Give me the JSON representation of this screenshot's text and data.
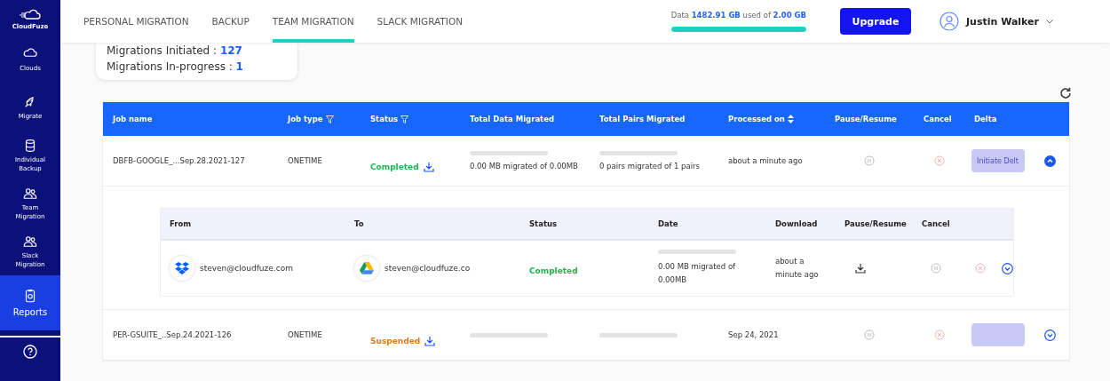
{
  "sidebar": {
    "brand": "CloudFuze",
    "items": [
      {
        "label": "Clouds",
        "selected": false
      },
      {
        "label": "Migrate",
        "selected": false
      },
      {
        "label": "Individual Backup",
        "selected": false
      },
      {
        "label": "Team Migration",
        "selected": false
      },
      {
        "label": "Slack Migration",
        "selected": false
      },
      {
        "label": "Reports",
        "selected": true
      }
    ]
  },
  "tabs": [
    {
      "label": "PERSONAL MIGRATION",
      "selected": false
    },
    {
      "label": "BACKUP",
      "selected": false
    },
    {
      "label": "TEAM MIGRATION",
      "selected": true
    },
    {
      "label": "SLACK MIGRATION",
      "selected": false
    }
  ],
  "storage": {
    "text": "Data **1482.91 GB** used of **2.00 GB**",
    "level": 1
  },
  "upgrade_button": "Upgrade",
  "user": {
    "name": "Justin Walker"
  },
  "stats": [
    {
      "label": "Migrations Initiated :",
      "value": "127"
    },
    {
      "label": "Migrations In-progress :",
      "value": "1"
    }
  ],
  "table": {
    "columns": [
      "Job name",
      "Job type",
      "Status",
      "Total Data Migrated",
      "Total Pairs Migrated",
      "Processed on",
      "Pause/Resume",
      "Cancel",
      "Delta"
    ],
    "rows": [
      {
        "job_name": "DBFB-GOOGLE_...Sep.28.2021-127",
        "job_type": "ONETIME",
        "status": {
          "text": "Completed",
          "kind": "completed"
        },
        "data": {
          "level": 0,
          "text": "0.00 MB migrated of 0.00MB"
        },
        "pairs": {
          "level": 0,
          "text": "0 pairs migrated of 1 pairs"
        },
        "processed_on": "about a minute ago",
        "delta_button": "Initiate Delt",
        "expanded": true,
        "details": {
          "columns": [
            "From",
            "To",
            "Status",
            "Date",
            "Download",
            "Pause/Resume",
            "Cancel"
          ],
          "rows": [
            {
              "from": "steven@cloudfuze.com",
              "to": "steven@cloudfuze.co",
              "status": {
                "text": "Completed",
                "kind": "completed"
              },
              "progress": {
                "level": 0,
                "text": "0.00 MB migrated of 0.00MB"
              },
              "time": "about a minute ago"
            }
          ]
        }
      },
      {
        "job_name": "PER-GSUITE_..Sep.24.2021-126",
        "job_type": "ONETIME",
        "status": {
          "text": "Suspended",
          "kind": "suspended"
        },
        "data": {
          "level": 0
        },
        "pairs": {
          "level": 0
        },
        "processed_on": "Sep 24, 2021",
        "expanded": false
      }
    ]
  }
}
